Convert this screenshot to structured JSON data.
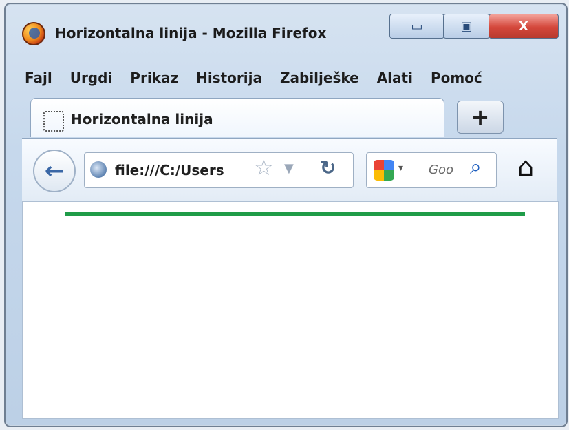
{
  "window": {
    "title": "Horizontalna linija - Mozilla Firefox",
    "controls": {
      "minimize_label": "▭",
      "maximize_label": "▣",
      "close_label": "X"
    }
  },
  "menubar": {
    "items": [
      "Fajl",
      "Urgdi",
      "Prikaz",
      "Historija",
      "Zabilješke",
      "Alati",
      "Pomoć"
    ]
  },
  "tab": {
    "label": "Horizontalna linija",
    "new_tab_label": "+"
  },
  "navigation": {
    "address_value": "file:///C:/Users",
    "search_placeholder": "Goo"
  },
  "content": {
    "hr_color": "#1f9c48"
  },
  "icons": {
    "app": "firefox-logo-icon",
    "tab": "page-icon",
    "back": "back-arrow-icon",
    "address": "globe-icon",
    "bookmark": "star-icon",
    "history": "dropdown-icon",
    "reload": "reload-icon",
    "search_provider": "google-icon",
    "search": "search-icon",
    "home": "home-icon"
  }
}
